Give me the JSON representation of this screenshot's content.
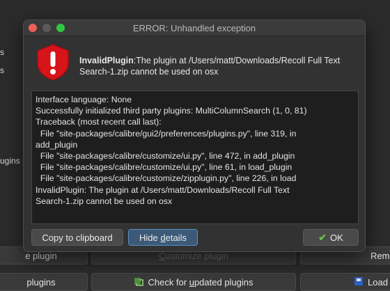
{
  "background": {
    "left_fragment_1": "s",
    "left_fragment_2": "s",
    "left_fragment_3": "ugins",
    "row1_left_button": "e plugin",
    "row1_middle_button_prefix": "",
    "row1_middle_button_underline": "C",
    "row1_middle_button_suffix": "ustomize plugin",
    "row1_right_button": "Rem",
    "row2_left_button": "plugins",
    "row2_middle_button_prefix": "Check for ",
    "row2_middle_button_underline": "u",
    "row2_middle_button_suffix": "pdated plugins",
    "row2_right_button": "Load"
  },
  "dialog": {
    "title": "ERROR: Unhandled exception",
    "icon": "error-shield-icon",
    "message_bold": "InvalidPlugin",
    "message_rest": ":The plugin at /Users/matt/Downloads/Recoll Full Text Search-1.zip cannot be used on osx",
    "details": [
      "Interface language: None",
      "Successfully initialized third party plugins: MultiColumnSearch (1, 0, 81)",
      "Traceback (most recent call last):",
      "  File \"site-packages/calibre/gui2/preferences/plugins.py\", line 319, in",
      "add_plugin",
      "  File \"site-packages/calibre/customize/ui.py\", line 472, in add_plugin",
      "  File \"site-packages/calibre/customize/ui.py\", line 61, in load_plugin",
      "  File \"site-packages/calibre/customize/zipplugin.py\", line 226, in load",
      "InvalidPlugin: The plugin at /Users/matt/Downloads/Recoll Full Text",
      "Search-1.zip cannot be used on osx"
    ],
    "copy_button": "Copy to clipboard",
    "hide_prefix": "Hide ",
    "hide_underline": "d",
    "hide_suffix": "etails",
    "ok_button": "OK"
  },
  "colors": {
    "error_red": "#d7141a",
    "ok_green": "#6cc04a"
  }
}
